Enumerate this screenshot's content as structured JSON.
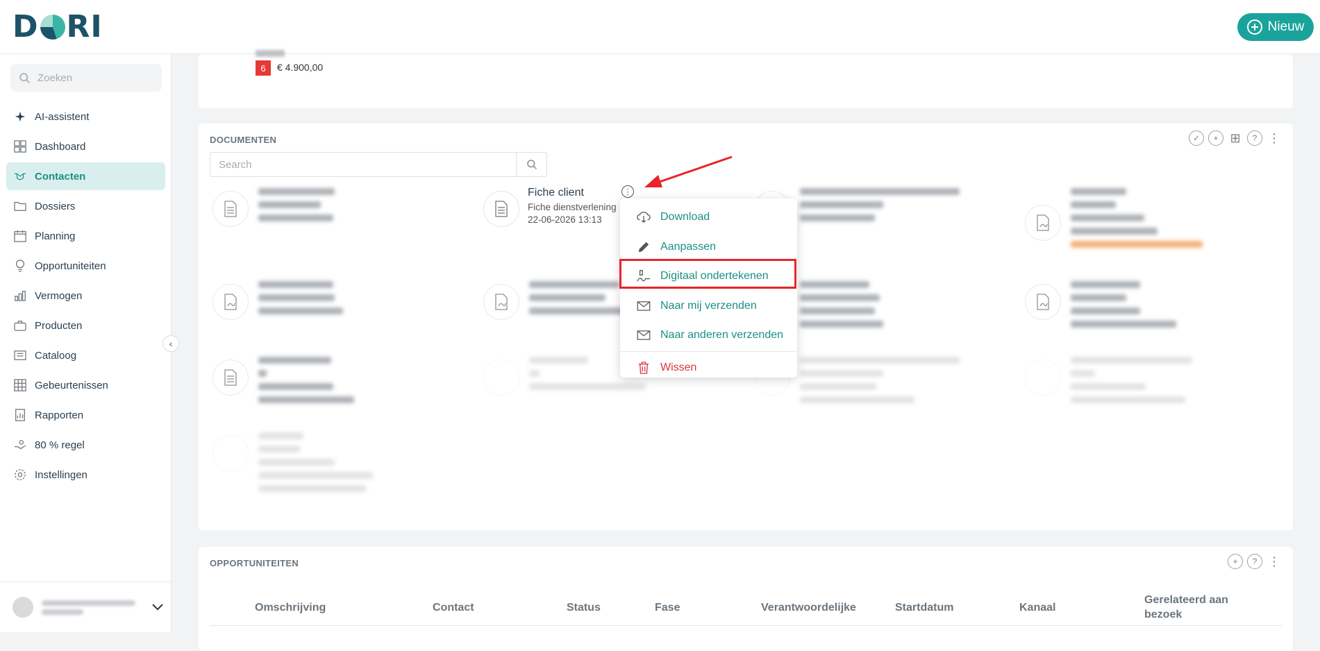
{
  "app": {
    "logo": "DORI",
    "new_button": "Nieuw"
  },
  "sidebar": {
    "search_placeholder": "Zoeken",
    "items": [
      {
        "label": "AI-assistent",
        "icon": "sparkle-icon",
        "active": false
      },
      {
        "label": "Dashboard",
        "icon": "dashboard-icon",
        "active": false
      },
      {
        "label": "Contacten",
        "icon": "handshake-icon",
        "active": true
      },
      {
        "label": "Dossiers",
        "icon": "folder-icon",
        "active": false
      },
      {
        "label": "Planning",
        "icon": "calendar-icon",
        "active": false
      },
      {
        "label": "Opportuniteiten",
        "icon": "lightbulb-icon",
        "active": false
      },
      {
        "label": "Vermogen",
        "icon": "wealth-icon",
        "active": false
      },
      {
        "label": "Producten",
        "icon": "briefcase-icon",
        "active": false
      },
      {
        "label": "Cataloog",
        "icon": "catalog-icon",
        "active": false
      },
      {
        "label": "Gebeurtenissen",
        "icon": "events-icon",
        "active": false
      },
      {
        "label": "Rapporten",
        "icon": "reports-icon",
        "active": false
      },
      {
        "label": "80 % regel",
        "icon": "percent-hand-icon",
        "active": false
      },
      {
        "label": "Instellingen",
        "icon": "gear-icon",
        "active": false
      }
    ]
  },
  "top_card": {
    "badge": "6",
    "amount": "€ 4.900,00"
  },
  "documents": {
    "title": "DOCUMENTEN",
    "search_placeholder": "Search",
    "visible_doc": {
      "title": "Fiche client",
      "type": "Fiche dienstverlening",
      "date": "22-06-2026 13:13"
    },
    "menu": [
      {
        "label": "Download",
        "icon": "cloud-download-icon"
      },
      {
        "label": "Aanpassen",
        "icon": "pencil-icon"
      },
      {
        "label": "Digitaal ondertekenen",
        "icon": "signature-icon"
      },
      {
        "label": "Naar mij verzenden",
        "icon": "envelope-icon"
      },
      {
        "label": "Naar anderen verzenden",
        "icon": "envelope-icon"
      },
      {
        "label": "Wissen",
        "icon": "trash-icon"
      }
    ]
  },
  "opportunities": {
    "title": "OPPORTUNITEITEN",
    "columns": [
      "Omschrijving",
      "Contact",
      "Status",
      "Fase",
      "Verantwoordelijke",
      "Startdatum",
      "Kanaal",
      "Gerelateerd aan bezoek"
    ]
  }
}
